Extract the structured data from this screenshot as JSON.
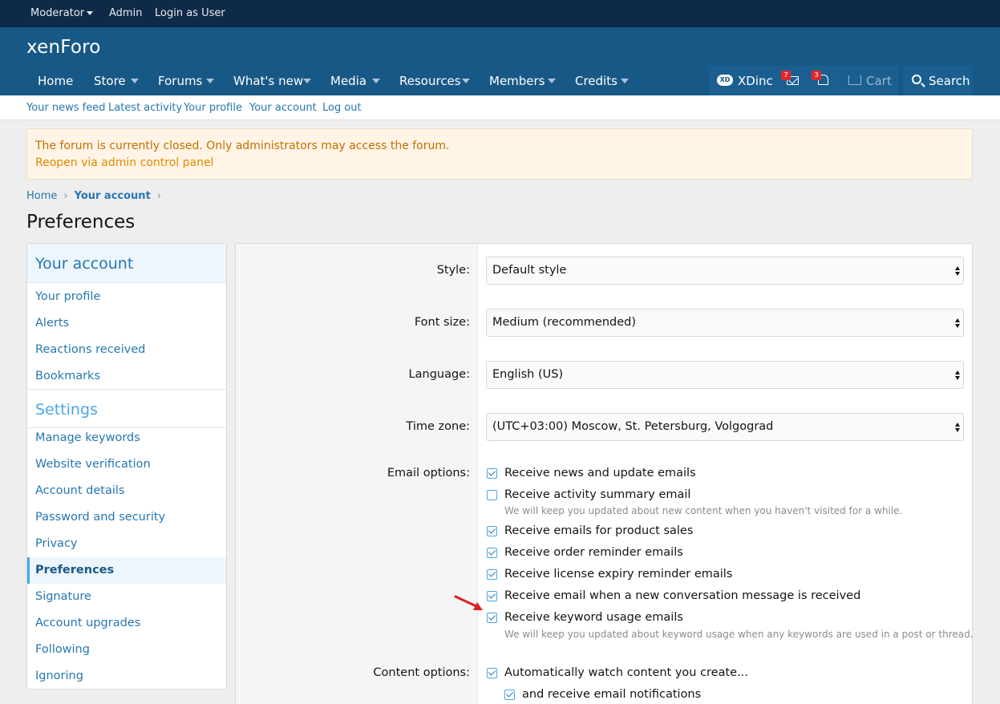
{
  "staffbar": {
    "moderator": "Moderator",
    "admin": "Admin",
    "login_as_user": "Login as User"
  },
  "header": {
    "logo": "xenForo",
    "nav": [
      {
        "label": "Home"
      },
      {
        "label": "Store"
      },
      {
        "label": "Forums"
      },
      {
        "label": "What's new"
      },
      {
        "label": "Media"
      },
      {
        "label": "Resources"
      },
      {
        "label": "Members"
      },
      {
        "label": "Credits"
      }
    ],
    "user": {
      "icon_text": "XD",
      "name": "XDinc",
      "conversations_badge": "7",
      "alerts_badge": "3",
      "cart": "Cart"
    },
    "search": "Search"
  },
  "subnav": [
    "Your news feed",
    "Latest activity",
    "Your profile",
    "Your account",
    "Log out"
  ],
  "notice": {
    "message": "The forum is currently closed. Only administrators may access the forum.",
    "link": "Reopen via admin control panel"
  },
  "breadcrumb": {
    "home": "Home",
    "current": "Your account"
  },
  "page_title": "Preferences",
  "sidebar": {
    "account_heading": "Your account",
    "account_items": [
      "Your profile",
      "Alerts",
      "Reactions received",
      "Bookmarks"
    ],
    "settings_heading": "Settings",
    "settings_items": [
      "Manage keywords",
      "Website verification",
      "Account details",
      "Password and security",
      "Privacy",
      "Preferences",
      "Signature",
      "Account upgrades",
      "Following",
      "Ignoring"
    ],
    "active_item": "Preferences"
  },
  "form": {
    "style": {
      "label": "Style:",
      "value": "Default style"
    },
    "font_size": {
      "label": "Font size:",
      "value": "Medium (recommended)"
    },
    "language": {
      "label": "Language:",
      "value": "English (US)"
    },
    "timezone": {
      "label": "Time zone:",
      "value": "(UTC+03:00) Moscow, St. Petersburg, Volgograd"
    },
    "email_label": "Email options:",
    "email_options": [
      {
        "label": "Receive news and update emails",
        "checked": true
      },
      {
        "label": "Receive activity summary email",
        "checked": false,
        "hint": "We will keep you updated about new content when you haven't visited for a while."
      },
      {
        "label": "Receive emails for product sales",
        "checked": true
      },
      {
        "label": "Receive order reminder emails",
        "checked": true
      },
      {
        "label": "Receive license expiry reminder emails",
        "checked": true
      },
      {
        "label": "Receive email when a new conversation message is received",
        "checked": true
      },
      {
        "label": "Receive keyword usage emails",
        "checked": true,
        "hint": "We will keep you updated about keyword usage when any keywords are used in a post or thread."
      }
    ],
    "content_label": "Content options:",
    "content_options": [
      {
        "label": "Automatically watch content you create...",
        "checked": true
      },
      {
        "label": "and receive email notifications",
        "checked": true
      }
    ]
  },
  "colors": {
    "header": "#185886",
    "staffbar": "#0f2a48",
    "link": "#2577b1",
    "accent": "#47a7eb",
    "notice_text": "#c56e00",
    "annotation_arrow": "#e02020"
  }
}
